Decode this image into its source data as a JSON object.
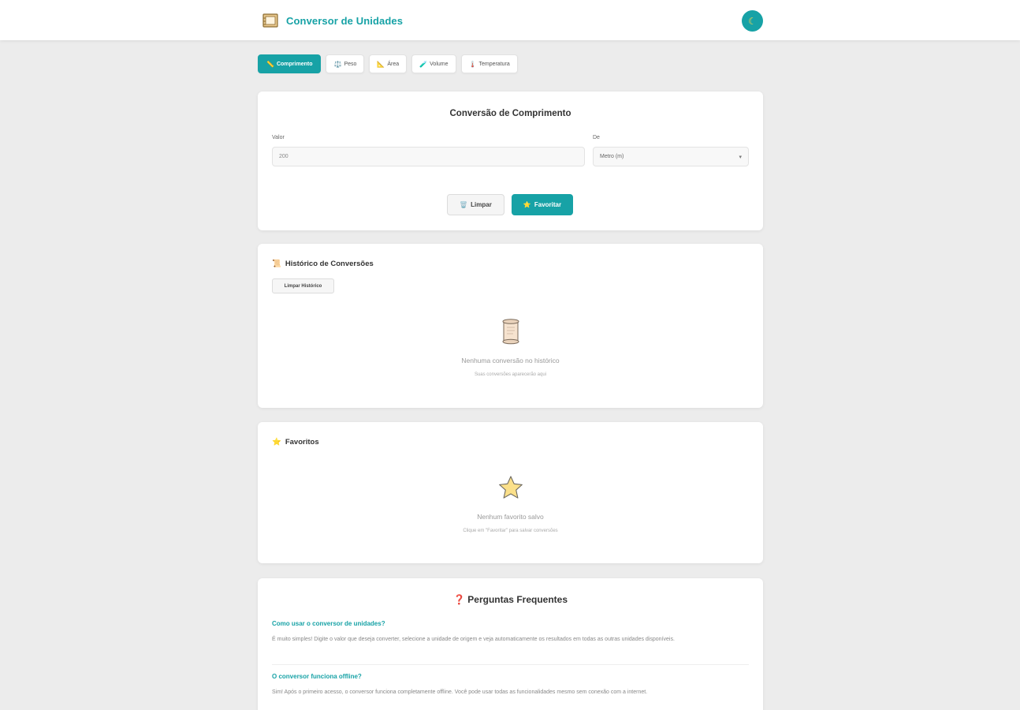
{
  "header": {
    "title": "Conversor de Unidades",
    "theme_toggle_icon": "moon-icon"
  },
  "tabs": [
    {
      "label": "Comprimento",
      "icon": "📏",
      "active": true
    },
    {
      "label": "Peso",
      "icon": "⚖️",
      "active": false
    },
    {
      "label": "Área",
      "icon": "📐",
      "active": false
    },
    {
      "label": "Volume",
      "icon": "🧪",
      "active": false
    },
    {
      "label": "Temperatura",
      "icon": "🌡️",
      "active": false
    }
  ],
  "converter": {
    "title": "Conversão de Comprimento",
    "value_label": "Valor",
    "value": "200",
    "from_label": "De",
    "from_selected": "Metro (m)",
    "clear_label": "Limpar",
    "clear_icon": "🗑️",
    "favorite_label": "Favoritar",
    "favorite_icon": "⭐"
  },
  "history": {
    "icon": "📜",
    "title": "Histórico de Conversões",
    "clear_label": "Limpar Histórico",
    "empty_title": "Nenhuma conversão no histórico",
    "empty_sub": "Suas conversões aparecerão aqui"
  },
  "favorites": {
    "icon": "⭐",
    "title": "Favoritos",
    "empty_title": "Nenhum favorito salvo",
    "empty_sub": "Clique em \"Favoritar\" para salvar conversões"
  },
  "faq": {
    "icon": "❓",
    "title": "Perguntas Frequentes",
    "items": [
      {
        "q": "Como usar o conversor de unidades?",
        "a": "É muito simples! Digite o valor que deseja converter, selecione a unidade de origem e veja automaticamente os resultados em todas as outras unidades disponíveis."
      },
      {
        "q": "O conversor funciona offline?",
        "a": "Sim! Após o primeiro acesso, o conversor funciona completamente offline. Você pode usar todas as funcionalidades mesmo sem conexão com a internet."
      }
    ]
  },
  "colors": {
    "accent": "#17a2a6",
    "background": "#ececec"
  }
}
